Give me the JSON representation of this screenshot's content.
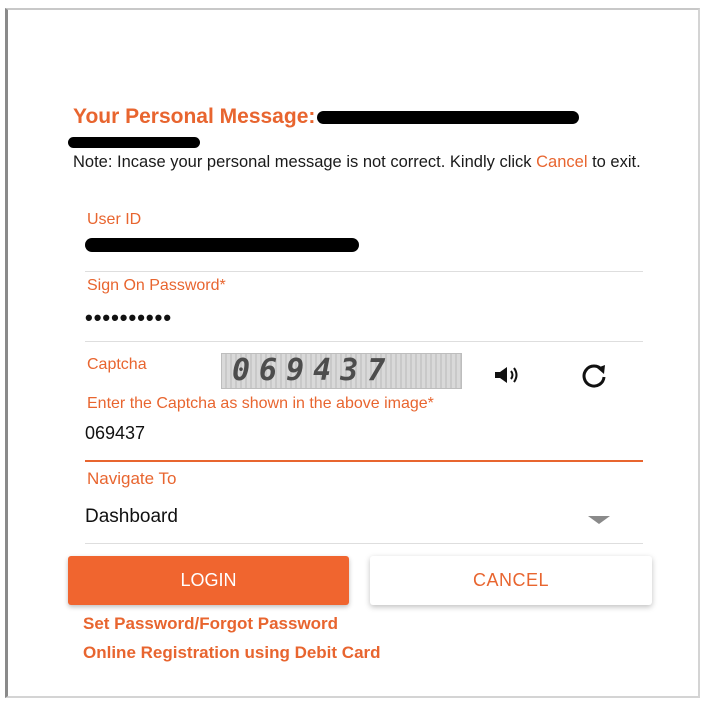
{
  "personal_message": {
    "title": "Your Personal Message:",
    "note_prefix": "Note: Incase your personal message is not correct. Kindly click ",
    "note_link": "Cancel",
    "note_suffix": " to exit."
  },
  "user_id": {
    "label": "User ID"
  },
  "password": {
    "label": "Sign On Password*",
    "masked_value": "••••••••••"
  },
  "captcha": {
    "label": "Captcha",
    "image_text": "069437",
    "input_label": "Enter the Captcha as shown in the above image*",
    "input_value": "069437",
    "audio_icon": "speaker-icon",
    "refresh_icon": "refresh-icon"
  },
  "navigate": {
    "label": "Navigate To",
    "selected": "Dashboard"
  },
  "buttons": {
    "login": "LOGIN",
    "cancel": "CANCEL"
  },
  "links": {
    "forgot_password": "Set Password/Forgot Password",
    "online_registration": "Online Registration using Debit Card"
  },
  "colors": {
    "accent": "#e8652f",
    "login_button": "#f0652f"
  }
}
